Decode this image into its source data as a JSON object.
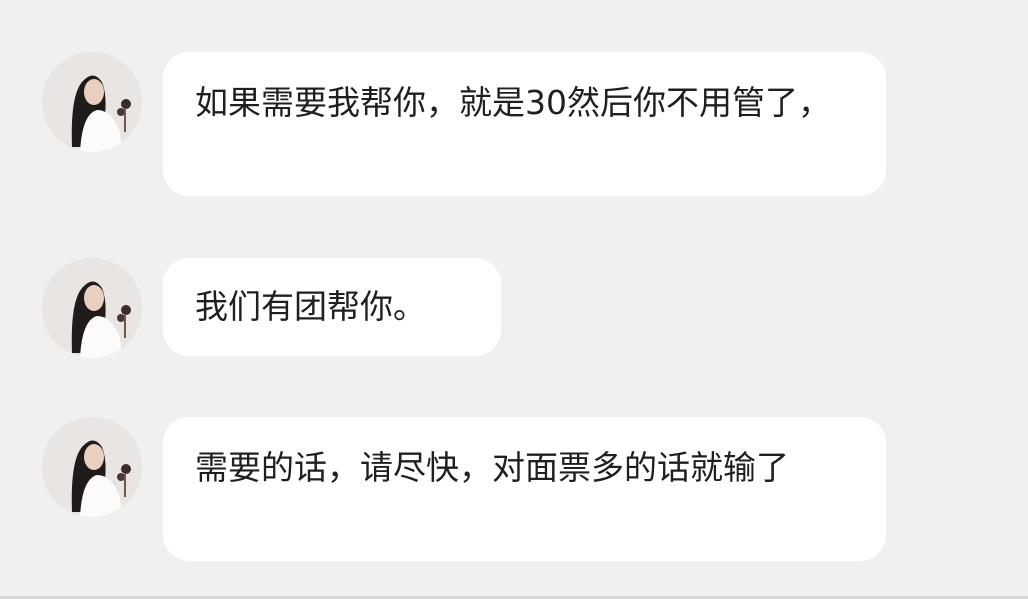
{
  "top_partial": "",
  "messages": [
    {
      "text": "如果需要我帮你，就是30然后你不用管了，"
    },
    {
      "text": "我们有团帮你。"
    },
    {
      "text": "需要的话，请尽快，对面票多的话就输了"
    }
  ],
  "colors": {
    "background": "#f0f0f0",
    "bubble": "#ffffff",
    "text": "#1f1f1f"
  }
}
